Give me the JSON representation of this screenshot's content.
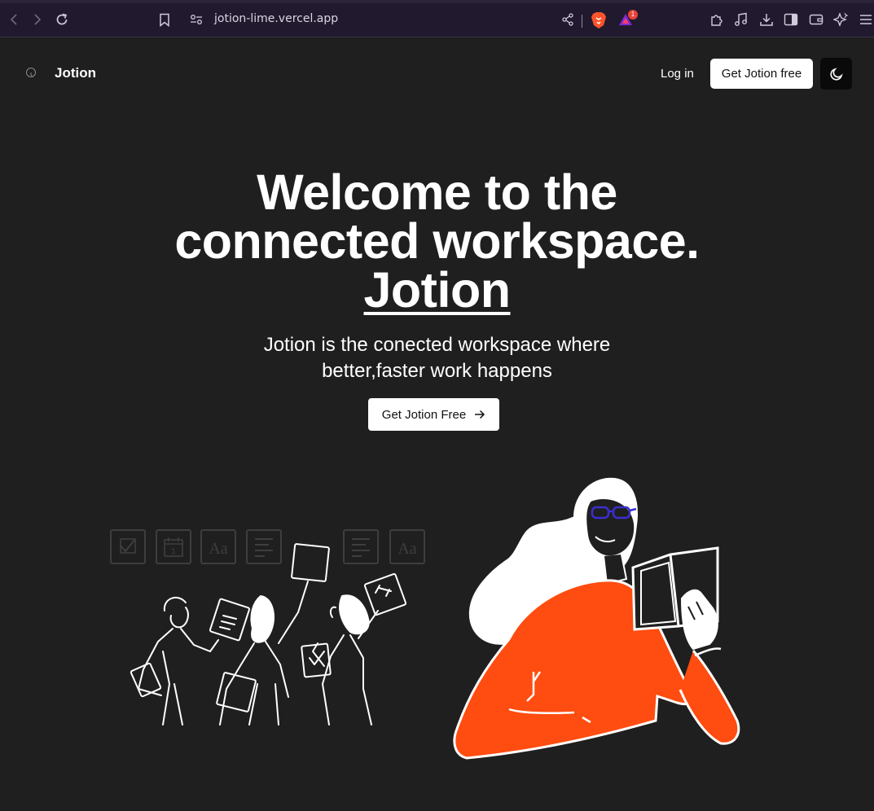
{
  "browser": {
    "url": "jotion-lime.vercel.app",
    "notification_count": "1"
  },
  "header": {
    "logo_text": "Jotion",
    "login_label": "Log in",
    "cta_label": "Get Jotion free"
  },
  "hero": {
    "title_line1": "Welcome to the",
    "title_line2": "connected workspace.",
    "title_brand": "Jotion",
    "subtitle_line1": "Jotion is the conected workspace where",
    "subtitle_line2": "better,faster work happens",
    "cta_label": "Get Jotion Free"
  },
  "icons": {
    "card_text": "Aa",
    "calendar_day": "1"
  },
  "colors": {
    "background": "#1f1f1f",
    "accent_orange": "#ff4c10",
    "glasses": "#3b2ed0",
    "browser_bar": "#211a2e"
  }
}
